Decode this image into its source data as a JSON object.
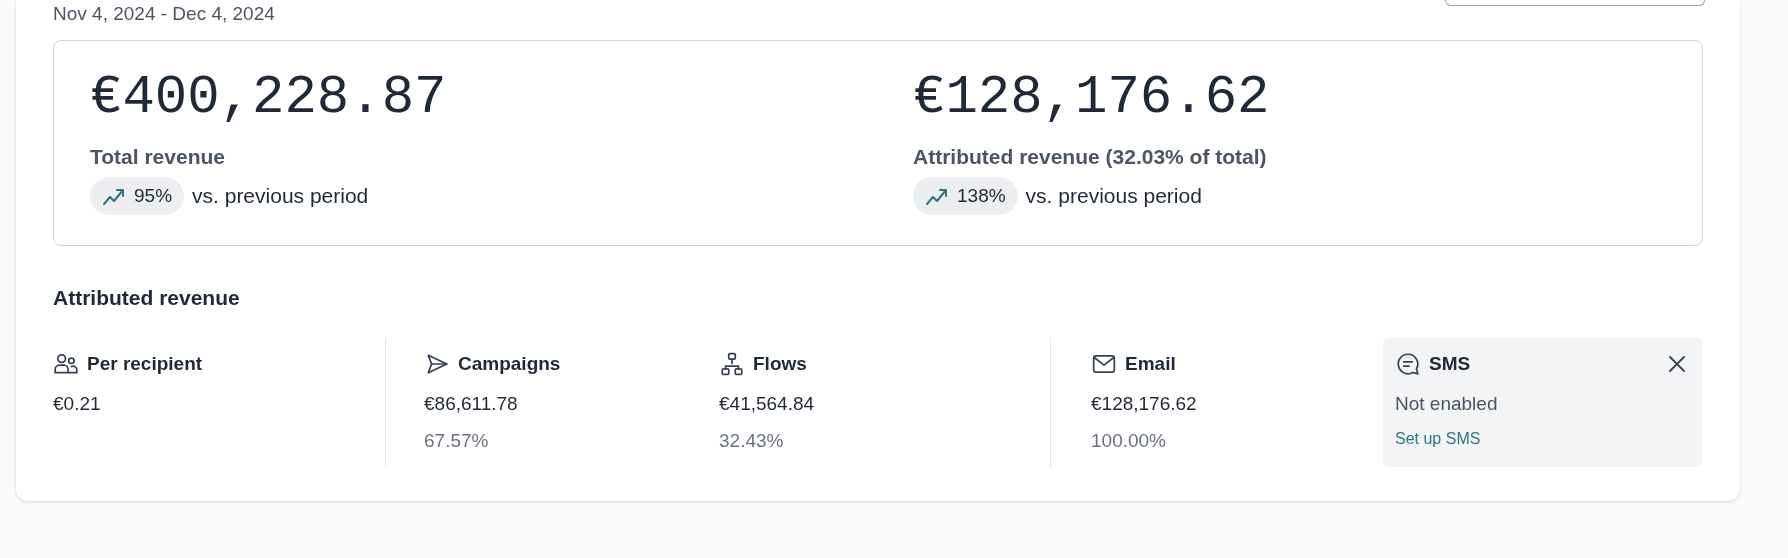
{
  "date_range": "Nov 4, 2024 - Dec 4, 2024",
  "summary": [
    {
      "amount": "€400,228.87",
      "label": "Total revenue",
      "change": "95%",
      "comparison": "vs. previous period"
    },
    {
      "amount": "€128,176.62",
      "label": "Attributed revenue (32.03% of total)",
      "change": "138%",
      "comparison": "vs. previous period"
    }
  ],
  "section_title": "Attributed revenue",
  "groups": [
    [
      {
        "kind": "people",
        "title": "Per recipient",
        "value": "€0.21"
      }
    ],
    [
      {
        "kind": "send",
        "title": "Campaigns",
        "value": "€86,611.78",
        "share": "67.57%"
      },
      {
        "kind": "flow",
        "title": "Flows",
        "value": "€41,564.84",
        "share": "32.43%"
      }
    ],
    [
      {
        "kind": "mail",
        "title": "Email",
        "value": "€128,176.62",
        "share": "100.00%"
      }
    ]
  ],
  "sms": {
    "title": "SMS",
    "status": "Not enabled",
    "link": "Set up SMS"
  }
}
